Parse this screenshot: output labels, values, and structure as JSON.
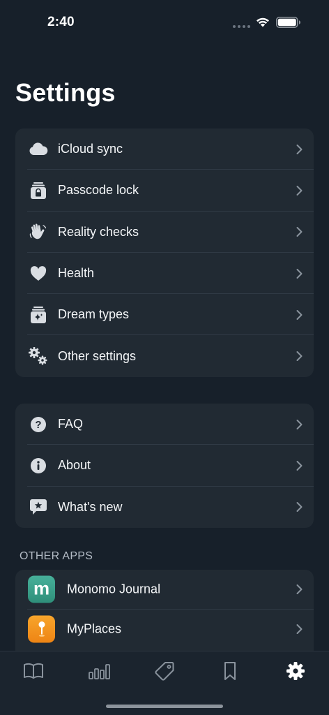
{
  "status_bar": {
    "time": "2:40"
  },
  "page": {
    "title": "Settings"
  },
  "group1": [
    {
      "label": "iCloud sync",
      "icon": "cloud-icon"
    },
    {
      "label": "Passcode lock",
      "icon": "lock-icon"
    },
    {
      "label": "Reality checks",
      "icon": "hand-wave-icon"
    },
    {
      "label": "Health",
      "icon": "heart-icon"
    },
    {
      "label": "Dream types",
      "icon": "sparkle-tray-icon"
    },
    {
      "label": "Other settings",
      "icon": "gears-icon"
    }
  ],
  "group2": [
    {
      "label": "FAQ",
      "icon": "question-icon"
    },
    {
      "label": "About",
      "icon": "info-icon"
    },
    {
      "label": "What's new",
      "icon": "star-bubble-icon"
    }
  ],
  "other_apps": {
    "header": "OTHER APPS",
    "items": [
      {
        "label": "Monomo Journal",
        "icon": "monomo-app-icon",
        "icon_letter": "m",
        "color": "#3aa38c"
      },
      {
        "label": "MyPlaces",
        "icon": "myplaces-app-icon",
        "color": "#f2931e"
      }
    ]
  },
  "tab_bar": {
    "tabs": [
      {
        "name": "journal-tab",
        "icon": "book-icon",
        "selected": false
      },
      {
        "name": "stats-tab",
        "icon": "bar-chart-icon",
        "selected": false
      },
      {
        "name": "tags-tab",
        "icon": "tag-icon",
        "selected": false
      },
      {
        "name": "bookmarks-tab",
        "icon": "bookmark-icon",
        "selected": false
      },
      {
        "name": "settings-tab",
        "icon": "gear-icon",
        "selected": true
      }
    ]
  },
  "colors": {
    "background": "#17202a",
    "card": "#212a33",
    "accent_selected": "#ffffff",
    "icon_inactive": "#8a939d"
  }
}
